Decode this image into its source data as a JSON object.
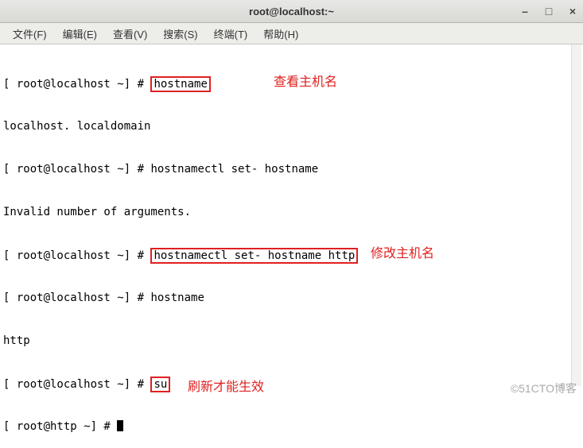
{
  "window": {
    "title": "root@localhost:~"
  },
  "menu": {
    "file": "文件(F)",
    "edit": "编辑(E)",
    "view": "查看(V)",
    "search": "搜索(S)",
    "terminal": "终端(T)",
    "help": "帮助(H)"
  },
  "terminal": {
    "l1_prompt": "[ root@localhost ~] # ",
    "l1_cmd": "hostname",
    "l2": "localhost. localdomain",
    "l3_prompt": "[ root@localhost ~] # ",
    "l3_cmd": "hostnamectl set- hostname",
    "l4": "Invalid number of arguments.",
    "l5_prompt": "[ root@localhost ~] # ",
    "l5_cmd": "hostnamectl set- hostname http",
    "l6_prompt": "[ root@localhost ~] # ",
    "l6_cmd": "hostname",
    "l7": "http",
    "l8_prompt": "[ root@localhost ~] # ",
    "l8_cmd": "su",
    "l9_prompt": "[ root@http ~] # "
  },
  "annotations": {
    "a1": "查看主机名",
    "a2": "修改主机名",
    "a3": "刷新才能生效"
  },
  "watermark": "©51CTO博客",
  "icons": {
    "minimize": "–",
    "maximize": "□",
    "close": "×"
  }
}
